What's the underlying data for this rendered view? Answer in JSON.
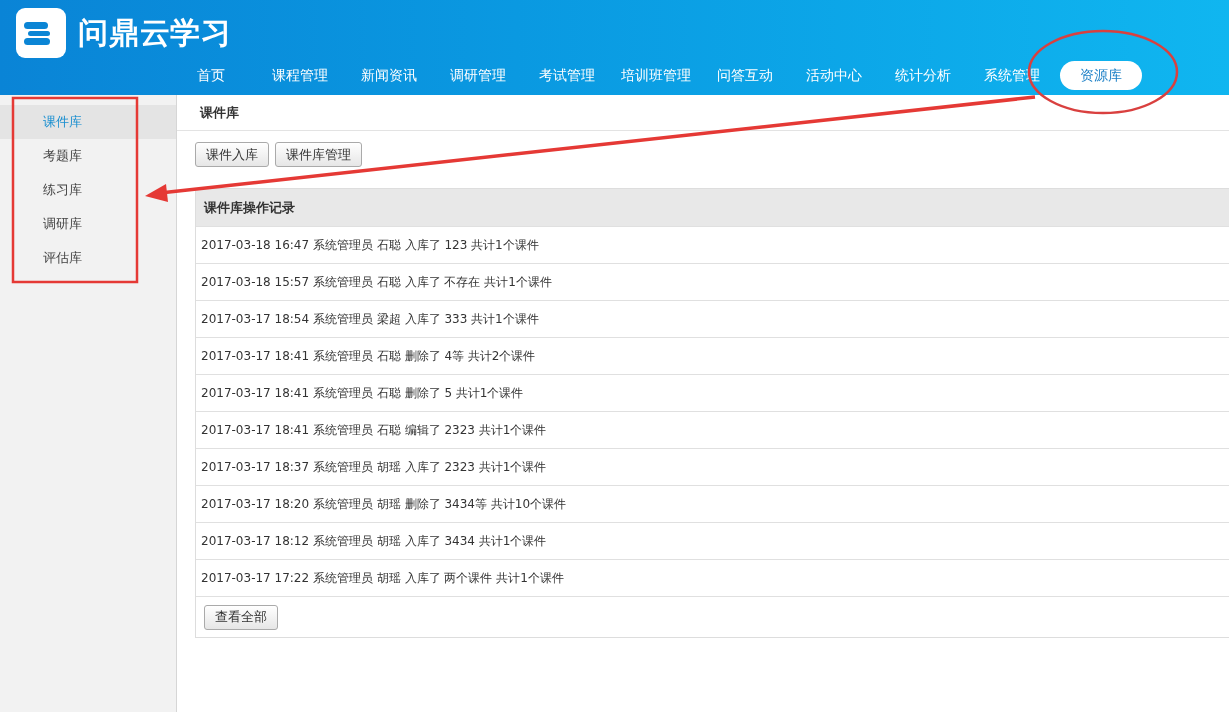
{
  "header": {
    "brand": "问鼎云学习"
  },
  "nav": [
    {
      "label": "首页",
      "selected": false
    },
    {
      "label": "课程管理",
      "selected": false
    },
    {
      "label": "新闻资讯",
      "selected": false
    },
    {
      "label": "调研管理",
      "selected": false
    },
    {
      "label": "考试管理",
      "selected": false
    },
    {
      "label": "培训班管理",
      "selected": false
    },
    {
      "label": "问答互动",
      "selected": false
    },
    {
      "label": "活动中心",
      "selected": false
    },
    {
      "label": "统计分析",
      "selected": false
    },
    {
      "label": "系统管理",
      "selected": false
    },
    {
      "label": "资源库",
      "selected": true
    }
  ],
  "sidebar": {
    "items": [
      {
        "label": "课件库",
        "selected": true
      },
      {
        "label": "考题库",
        "selected": false
      },
      {
        "label": "练习库",
        "selected": false
      },
      {
        "label": "调研库",
        "selected": false
      },
      {
        "label": "评估库",
        "selected": false
      }
    ]
  },
  "page": {
    "title": "课件库",
    "buttons": [
      "课件入库",
      "课件库管理"
    ]
  },
  "log": {
    "title": "课件库操作记录",
    "rows": [
      "2017-03-18 16:47 系统管理员 石聪 入库了 123 共计1个课件",
      "2017-03-18 15:57 系统管理员 石聪 入库了 不存在 共计1个课件",
      "2017-03-17 18:54 系统管理员 梁超 入库了 333 共计1个课件",
      "2017-03-17 18:41 系统管理员 石聪 删除了 4等 共计2个课件",
      "2017-03-17 18:41 系统管理员 石聪 删除了 5 共计1个课件",
      "2017-03-17 18:41 系统管理员 石聪 编辑了 2323 共计1个课件",
      "2017-03-17 18:37 系统管理员 胡瑶 入库了 2323 共计1个课件",
      "2017-03-17 18:20 系统管理员 胡瑶 删除了 3434等 共计10个课件",
      "2017-03-17 18:12 系统管理员 胡瑶 入库了 3434 共计1个课件",
      "2017-03-17 17:22 系统管理员 胡瑶 入库了 两个课件 共计1个课件"
    ],
    "footer_button": "查看全部"
  }
}
